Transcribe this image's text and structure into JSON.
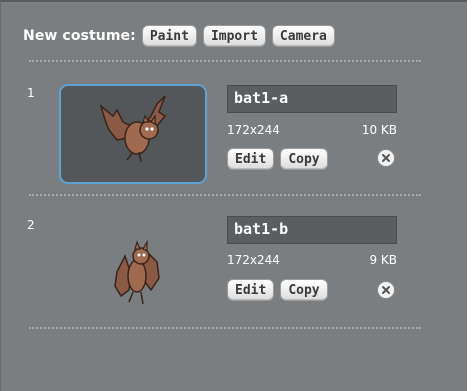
{
  "header": {
    "label": "New costume:",
    "buttons": {
      "paint": "Paint",
      "import": "Import",
      "camera": "Camera"
    }
  },
  "costumes": [
    {
      "index": "1",
      "name": "bat1-a",
      "dimensions": "172x244",
      "size": "10 KB",
      "edit_label": "Edit",
      "copy_label": "Copy",
      "selected": true
    },
    {
      "index": "2",
      "name": "bat1-b",
      "dimensions": "172x244",
      "size": "9 KB",
      "edit_label": "Edit",
      "copy_label": "Copy",
      "selected": false
    }
  ],
  "colors": {
    "panel_bg": "#7b7e80",
    "selected_border": "#5fa3d6",
    "name_field_bg": "#5b5e60"
  }
}
